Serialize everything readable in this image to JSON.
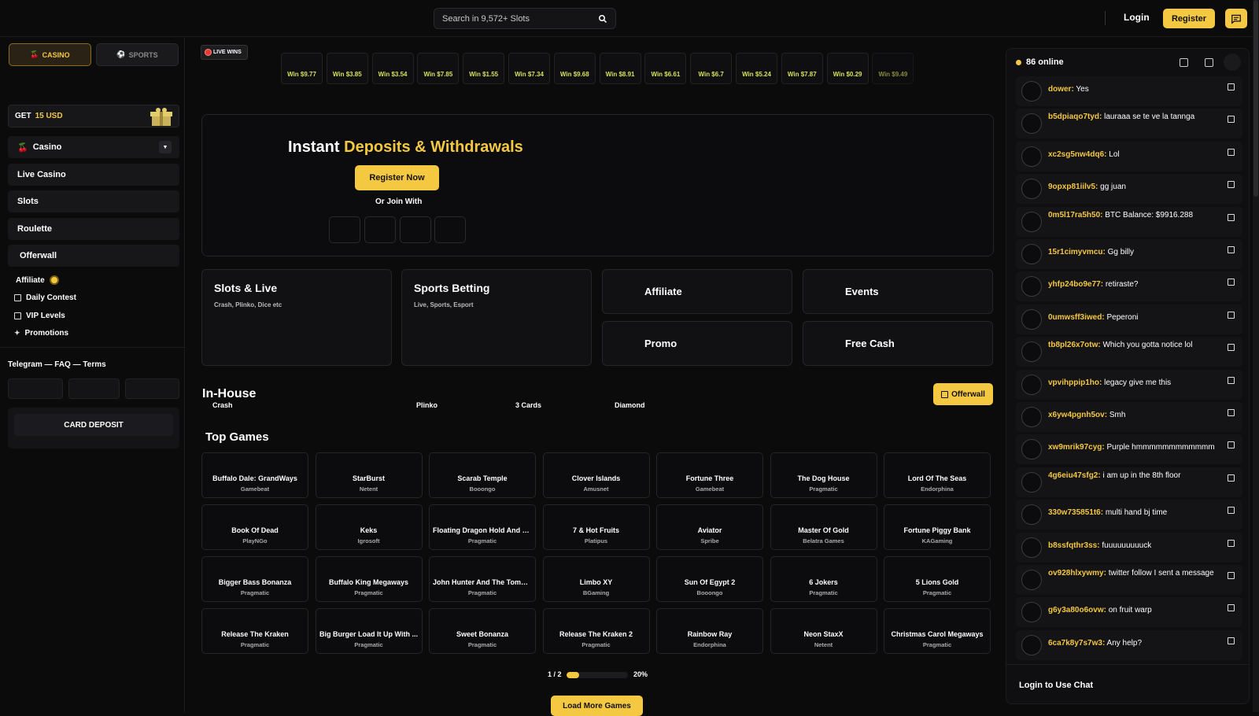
{
  "header": {
    "search_placeholder": "Search in 9,572+ Slots",
    "login": "Login",
    "register": "Register"
  },
  "sidebar": {
    "tab_casino": "CASINO",
    "tab_sports": "SPORTS",
    "promo_get": "GET",
    "promo_amount": "15 USD",
    "nav": [
      "Casino",
      "Live Casino",
      "Slots",
      "Roulette",
      "Offerwall"
    ],
    "sub": [
      "Affiliate",
      "Daily Contest",
      "VIP Levels",
      "Promotions"
    ],
    "links": "Telegram — FAQ  — Terms",
    "card_deposit": "CARD DEPOSIT"
  },
  "live_wins": {
    "label": "LIVE WINS",
    "wins": [
      "Win $9.77",
      "Win $3.85",
      "Win $3.54",
      "Win $7.85",
      "Win $1.55",
      "Win $7.34",
      "Win $9.68",
      "Win $8.91",
      "Win $6.61",
      "Win $6.7",
      "Win $5.24",
      "Win $7.87",
      "Win $0.29",
      "Win $9.49"
    ]
  },
  "hero": {
    "title_plain": "Instant ",
    "title_accent": "Deposits & Withdrawals",
    "register_now": "Register Now",
    "or_join": "Or Join With"
  },
  "cards": {
    "slots_title": "Slots & Live",
    "slots_sub": "Crash, Plinko, Dice etc",
    "sports_title": "Sports Betting",
    "sports_sub": "Live, Sports, Esport",
    "affiliate": "Affiliate",
    "events": "Events",
    "promo": "Promo",
    "free_cash": "Free Cash"
  },
  "inhouse": {
    "title": "In-House",
    "tabs": [
      "Crash",
      "Plinko",
      "3 Cards",
      "Diamond"
    ],
    "offerwall": "Offerwall"
  },
  "top_games": {
    "title": "Top Games",
    "games": [
      {
        "name": "Buffalo Dale: GrandWays",
        "provider": "Gamebeat"
      },
      {
        "name": "StarBurst",
        "provider": "Netent"
      },
      {
        "name": "Scarab Temple",
        "provider": "Booongo"
      },
      {
        "name": "Clover Islands",
        "provider": "Amusnet"
      },
      {
        "name": "Fortune Three",
        "provider": "Gamebeat"
      },
      {
        "name": "The Dog House",
        "provider": "Pragmatic"
      },
      {
        "name": "Lord Of The Seas",
        "provider": "Endorphina"
      },
      {
        "name": "Book Of Dead",
        "provider": "PlayNGo"
      },
      {
        "name": "Keks",
        "provider": "Igrosoft"
      },
      {
        "name": "Floating Dragon Hold And S...",
        "provider": "Pragmatic"
      },
      {
        "name": "7 & Hot Fruits",
        "provider": "Platipus"
      },
      {
        "name": "Aviator",
        "provider": "Spribe"
      },
      {
        "name": "Master Of Gold",
        "provider": "Belatra Games"
      },
      {
        "name": "Fortune Piggy Bank",
        "provider": "KAGaming"
      },
      {
        "name": "Bigger Bass Bonanza",
        "provider": "Pragmatic"
      },
      {
        "name": "Buffalo King Megaways",
        "provider": "Pragmatic"
      },
      {
        "name": "John Hunter And The Tomb ...",
        "provider": "Pragmatic"
      },
      {
        "name": "Limbo XY",
        "provider": "BGaming"
      },
      {
        "name": "Sun Of Egypt 2",
        "provider": "Booongo"
      },
      {
        "name": "6 Jokers",
        "provider": "Pragmatic"
      },
      {
        "name": "5 Lions Gold",
        "provider": "Pragmatic"
      },
      {
        "name": "Release The Kraken",
        "provider": "Pragmatic"
      },
      {
        "name": "Big Burger Load It Up With ...",
        "provider": "Pragmatic"
      },
      {
        "name": "Sweet Bonanza",
        "provider": "Pragmatic"
      },
      {
        "name": "Release The Kraken 2",
        "provider": "Pragmatic"
      },
      {
        "name": "Rainbow Ray",
        "provider": "Endorphina"
      },
      {
        "name": "Neon StaxX",
        "provider": "Netent"
      },
      {
        "name": "Christmas Carol Megaways",
        "provider": "Pragmatic"
      }
    ],
    "page": "1 / 2",
    "progress_percent": 20,
    "progress_label": "20%",
    "load_more": "Load More Games"
  },
  "chat": {
    "online": "86 online",
    "messages": [
      {
        "user": "dower:",
        "text": "Yes"
      },
      {
        "user": "b5dpiaqo7tyd:",
        "text": "lauraaa se te ve la tannga"
      },
      {
        "user": "xc2sg5nw4dq6:",
        "text": "Lol"
      },
      {
        "user": "9opxp81iilv5:",
        "text": "gg juan"
      },
      {
        "user": "0m5l17ra5h50:",
        "text": "BTC Balance: $9916.288"
      },
      {
        "user": "15r1cimyvmcu:",
        "text": "Gg billy"
      },
      {
        "user": "yhfp24bo9e77:",
        "text": "retiraste?"
      },
      {
        "user": "0umwsff3iwed:",
        "text": "Peperoni"
      },
      {
        "user": "tb8pl26x7otw:",
        "text": "Which you gotta notice lol"
      },
      {
        "user": "vpvihppip1ho:",
        "text": "legacy give me this"
      },
      {
        "user": "x6yw4pgnh5ov:",
        "text": "Smh"
      },
      {
        "user": "xw9mrik97cyg:",
        "text": "Purple hmmmmmmmmmmmm"
      },
      {
        "user": "4g6eiu47sfg2:",
        "text": "i am up in the 8th floor"
      },
      {
        "user": "330w735851t6:",
        "text": "multi hand bj time"
      },
      {
        "user": "b8ssfqthr3ss:",
        "text": "fuuuuuuuuuck"
      },
      {
        "user": "ov928hlxywmy:",
        "text": "twitter follow I sent a message"
      },
      {
        "user": "g6y3a80o6ovw:",
        "text": "on fruit warp"
      },
      {
        "user": "6ca7k8y7s7w3:",
        "text": "Any help?"
      }
    ],
    "footer": "Login to Use Chat"
  },
  "colors": {
    "accent": "#f5c842",
    "win_text": "#d4e157",
    "background": "#0b0b0c"
  }
}
